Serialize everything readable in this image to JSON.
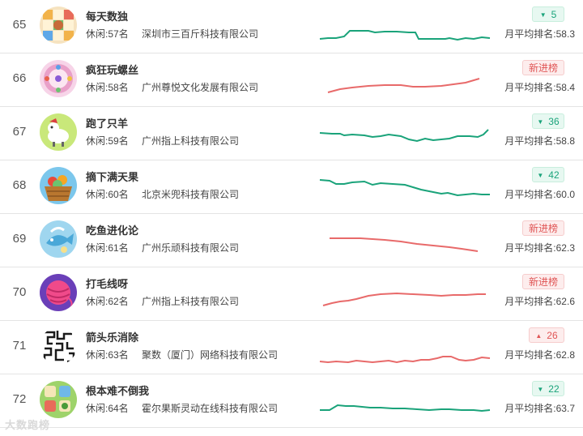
{
  "colors": {
    "down_green": "#1aa37a",
    "up_red": "#e05555",
    "new_red": "#e86a6a"
  },
  "rows": [
    {
      "rank": "65",
      "name": "每天数独",
      "category": "休闲:57名",
      "company": "深圳市三百斤科技有限公司",
      "badge_type": "down",
      "badge": "5",
      "avg": "月平均排名:58.3",
      "icon": "sudoku-app-icon"
    },
    {
      "rank": "66",
      "name": "疯狂玩螺丝",
      "category": "休闲:58名",
      "company": "广州尊悦文化发展有限公司",
      "badge_type": "new",
      "badge": "新进榜",
      "avg": "月平均排名:58.4",
      "icon": "screw-app-icon"
    },
    {
      "rank": "67",
      "name": "跑了只羊",
      "category": "休闲:59名",
      "company": "广州指上科技有限公司",
      "badge_type": "down",
      "badge": "36",
      "avg": "月平均排名:58.8",
      "icon": "sheep-app-icon"
    },
    {
      "rank": "68",
      "name": "摘下满天果",
      "category": "休闲:60名",
      "company": "北京米兜科技有限公司",
      "badge_type": "down",
      "badge": "42",
      "avg": "月平均排名:60.0",
      "icon": "fruit-basket-app-icon"
    },
    {
      "rank": "69",
      "name": "吃鱼进化论",
      "category": "休闲:61名",
      "company": "广州乐顽科技有限公司",
      "badge_type": "new",
      "badge": "新进榜",
      "avg": "月平均排名:62.3",
      "icon": "fish-app-icon"
    },
    {
      "rank": "70",
      "name": "打毛线呀",
      "category": "休闲:62名",
      "company": "广州指上科技有限公司",
      "badge_type": "new",
      "badge": "新进榜",
      "avg": "月平均排名:62.6",
      "icon": "yarn-app-icon"
    },
    {
      "rank": "71",
      "name": "箭头乐消除",
      "category": "休闲:63名",
      "company": "聚数（厦门）网络科技有限公司",
      "badge_type": "up",
      "badge": "26",
      "avg": "月平均排名:62.8",
      "icon": "arrow-maze-app-icon"
    },
    {
      "rank": "72",
      "name": "根本难不倒我",
      "category": "休闲:64名",
      "company": "霍尔果斯灵动在线科技有限公司",
      "badge_type": "down",
      "badge": "22",
      "avg": "月平均排名:63.7",
      "icon": "puzzle-app-icon"
    }
  ],
  "watermark": "大数跑榜"
}
